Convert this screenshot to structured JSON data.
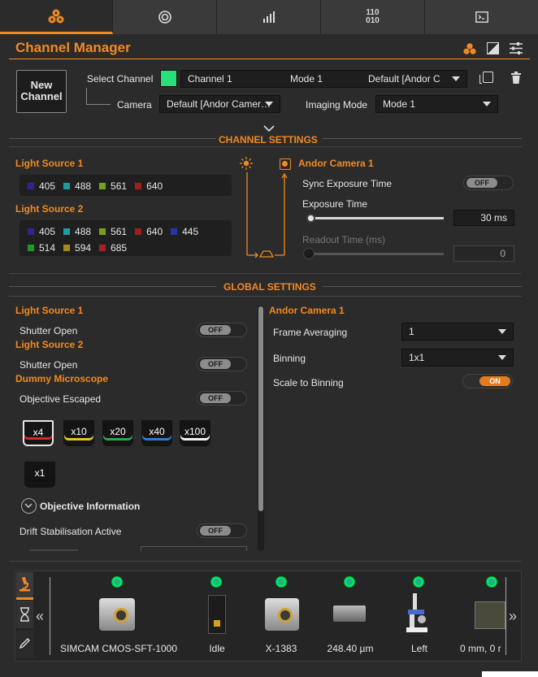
{
  "tabs": [
    {
      "icon": "cells-icon"
    },
    {
      "icon": "target-icon"
    },
    {
      "icon": "bar-chart-icon"
    },
    {
      "icon": "binary-icon",
      "label": "110\n010"
    },
    {
      "icon": "terminal-icon"
    }
  ],
  "header": {
    "title": "Channel Manager"
  },
  "new_channel": {
    "label_line1": "New",
    "label_line2": "Channel"
  },
  "select_channel": {
    "label": "Select Channel",
    "channel": "Channel 1",
    "mode": "Mode 1",
    "camera": "Default [Andor C",
    "swatch_color": "#27e07c"
  },
  "camera_row": {
    "label": "Camera",
    "value": "Default [Andor Camer…",
    "imaging_label": "Imaging Mode",
    "imaging_value": "Mode 1"
  },
  "channel_settings": {
    "title": "CHANNEL SETTINGS",
    "ls1": {
      "title": "Light Source 1",
      "lines": [
        {
          "v": "405",
          "c": "#3a1f8e"
        },
        {
          "v": "488",
          "c": "#1f9aa3"
        },
        {
          "v": "561",
          "c": "#77a021"
        },
        {
          "v": "640",
          "c": "#a01d1d"
        }
      ]
    },
    "ls2": {
      "title": "Light Source 2",
      "row1": [
        {
          "v": "405",
          "c": "#3a1f8e"
        },
        {
          "v": "488",
          "c": "#1f9aa3"
        },
        {
          "v": "561",
          "c": "#77a021"
        },
        {
          "v": "640",
          "c": "#a01d1d"
        },
        {
          "v": "445",
          "c": "#2436a8"
        }
      ],
      "row2": [
        {
          "v": "514",
          "c": "#1b9a2b"
        },
        {
          "v": "594",
          "c": "#a88a1c"
        },
        {
          "v": "685",
          "c": "#a81c2a"
        }
      ]
    },
    "camera": {
      "title": "Andor Camera 1",
      "sync_label": "Sync Exposure Time",
      "sync_state": "OFF",
      "exposure_label": "Exposure Time",
      "exposure_value": "30 ms",
      "readout_label": "Readout Time (ms)",
      "readout_value": "0"
    }
  },
  "global_settings": {
    "title": "GLOBAL SETTINGS",
    "ls1_title": "Light Source 1",
    "shutter1_label": "Shutter Open",
    "shutter1_state": "OFF",
    "ls2_title": "Light Source 2",
    "shutter2_label": "Shutter Open",
    "shutter2_state": "OFF",
    "micro_title": "Dummy Microscope",
    "objective_label": "Objective Escaped",
    "objective_state": "OFF",
    "objectives": [
      {
        "label": "x4",
        "c": "#d22a2a",
        "selected": true
      },
      {
        "label": "x10",
        "c": "#e8c227"
      },
      {
        "label": "x20",
        "c": "#2aa84a"
      },
      {
        "label": "x40",
        "c": "#2a7fd2"
      },
      {
        "label": "x100",
        "c": "#f0f0f0"
      },
      {
        "label": "x1",
        "c": "#111111"
      }
    ],
    "obj_info": "Objective Information",
    "drift_label": "Drift Stabilisation Active",
    "drift_state": "OFF",
    "camera_title": "Andor Camera 1",
    "frame_avg_label": "Frame Averaging",
    "frame_avg_value": "1",
    "binning_label": "Binning",
    "binning_value": "1x1",
    "scale_label": "Scale to Binning",
    "scale_state": "ON"
  },
  "devices": [
    {
      "label": "SIMCAM CMOS-SFT-1000"
    },
    {
      "label": "Idle"
    },
    {
      "label": "X-1383"
    },
    {
      "label": "248.40 µm"
    },
    {
      "label": "Left"
    },
    {
      "label": "0 mm, 0 r"
    }
  ]
}
